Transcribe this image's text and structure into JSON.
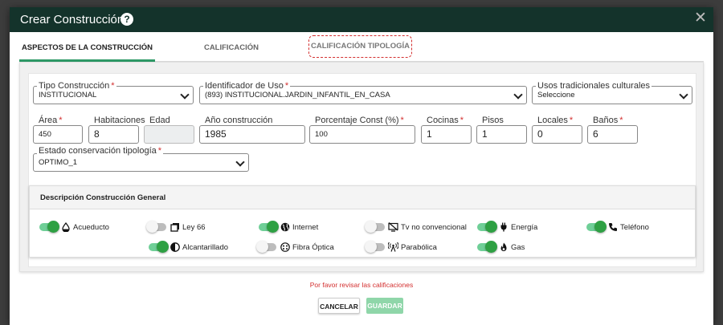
{
  "dialog": {
    "title": "Crear Construcción",
    "help_glyph": "?",
    "close_glyph": "✕"
  },
  "tabs": [
    {
      "label": "ASPECTOS DE LA CONSTRUCCIÓN",
      "active": true
    },
    {
      "label": "CALIFICACIÓN",
      "active": false
    },
    {
      "label": "CALIFICACIÓN TIPOLOGÍA",
      "active": false
    }
  ],
  "fields": {
    "tipo_construccion": {
      "label": "Tipo Construcción",
      "required": "*",
      "value": "INSTITUCIONAL"
    },
    "identificador_uso": {
      "label": "Identificador de Uso",
      "required": "*",
      "value": "(893) INSTITUCIONAL.JARDIN_INFANTIL_EN_CASA"
    },
    "usos_tradicionales": {
      "label": "Usos tradicionales culturales",
      "value": "Seleccione"
    },
    "area": {
      "label": "Área",
      "required": "*",
      "value": "450"
    },
    "habitaciones": {
      "label": "Habitaciones",
      "value": "8"
    },
    "edad": {
      "label": "Edad",
      "value": ""
    },
    "anio_construccion": {
      "label": "Año construcción",
      "value": "1985"
    },
    "porcentaje_const": {
      "label": "Porcentaje Const (%)",
      "required": "*",
      "value": "100"
    },
    "cocinas": {
      "label": "Cocinas",
      "required": "*",
      "value": "1"
    },
    "pisos": {
      "label": "Pisos",
      "value": "1"
    },
    "locales": {
      "label": "Locales",
      "required": "*",
      "value": "0"
    },
    "banos": {
      "label": "Baños",
      "required": "*",
      "value": "6"
    },
    "estado_conservacion": {
      "label": "Estado conservación tipología",
      "required": "*",
      "value": "OPTIMO_1"
    }
  },
  "descripcion": {
    "title": "Descripción Construcción General",
    "services": [
      {
        "label": "Acueducto",
        "on": true,
        "icon": "water-drop-icon"
      },
      {
        "label": "Ley 66",
        "on": false,
        "icon": "copy-icon"
      },
      {
        "label": "Internet",
        "on": true,
        "icon": "globe-icon"
      },
      {
        "label": "Tv no convencional",
        "on": false,
        "icon": "tv-off-icon"
      },
      {
        "label": "Energía",
        "on": true,
        "icon": "plug-icon"
      },
      {
        "label": "Teléfono",
        "on": true,
        "icon": "phone-icon"
      },
      {
        "label": "Alcantarillado",
        "on": true,
        "icon": "half-circle-icon"
      },
      {
        "label": "Fibra Óptica",
        "on": false,
        "icon": "fiber-optic-icon"
      },
      {
        "label": "Parabólica",
        "on": false,
        "icon": "satellite-antenna-icon"
      },
      {
        "label": "Gas",
        "on": true,
        "icon": "fire-icon"
      }
    ]
  },
  "footer": {
    "warning": "Por favor revisar las calificaciones",
    "cancel_label": "CANCELAR",
    "save_label": "GUARDAR"
  },
  "colors": {
    "header_bg": "#14332b",
    "accent_green": "#2ea043",
    "error_red": "#d32f2f",
    "disabled_save": "#8fd6a9"
  }
}
